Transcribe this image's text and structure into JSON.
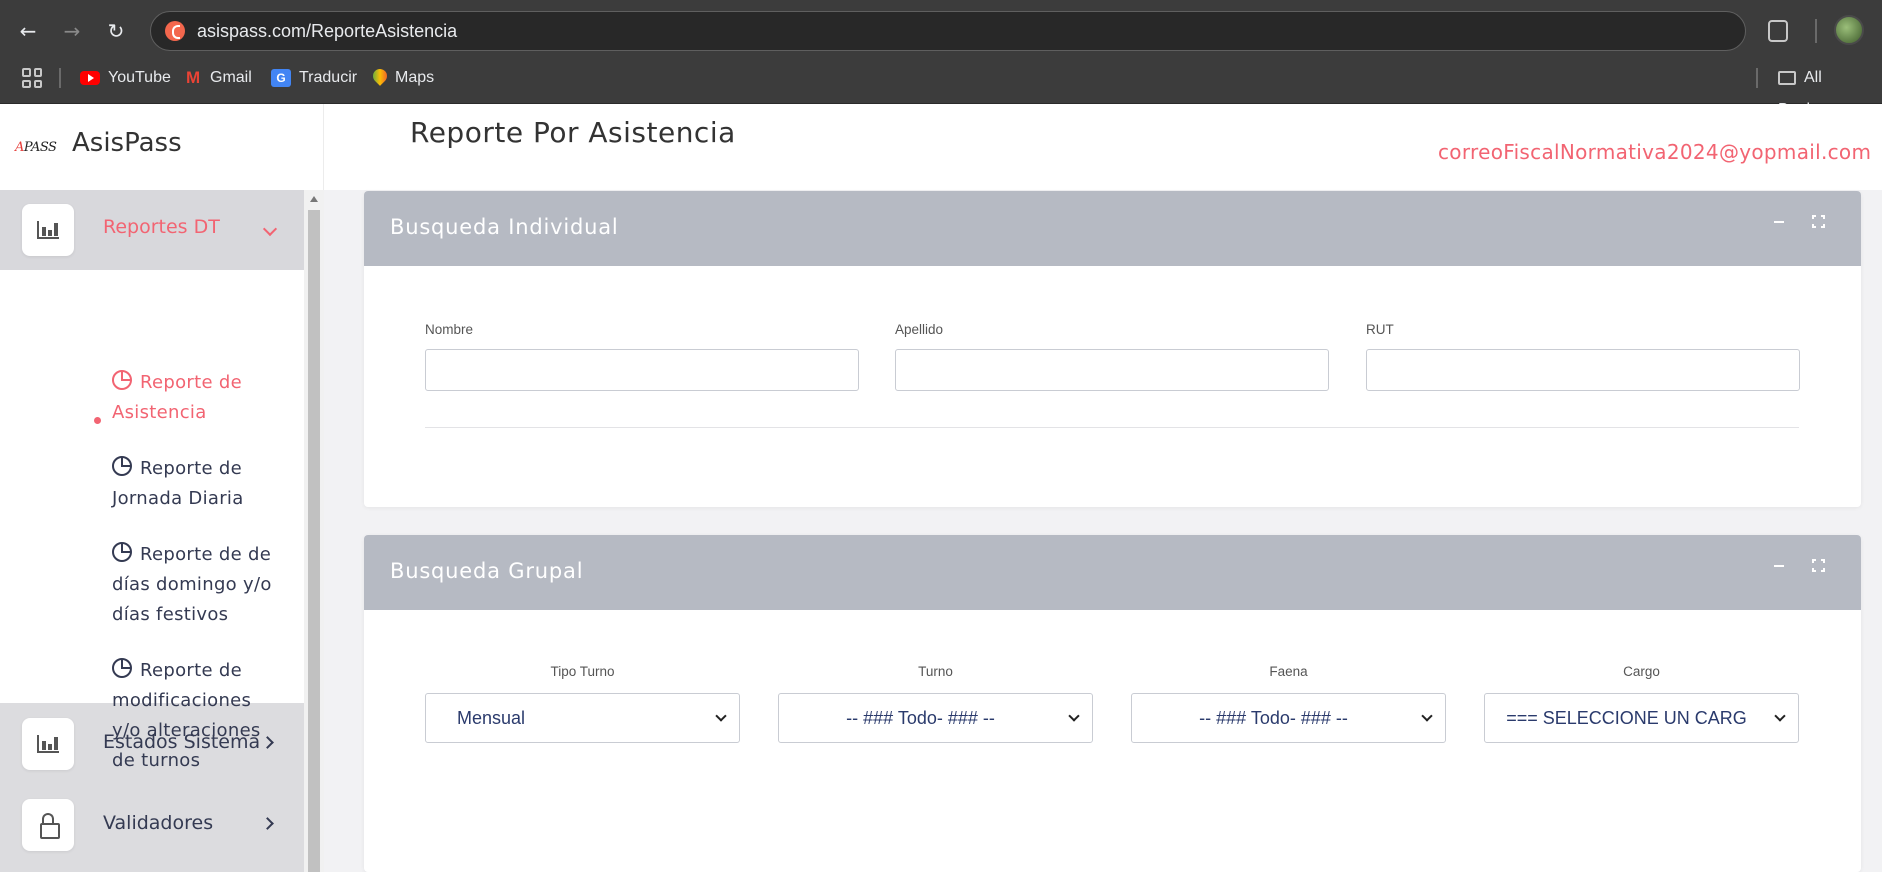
{
  "browser": {
    "url": "asispass.com/ReporteAsistencia",
    "bookmarks": [
      {
        "label": "YouTube",
        "icon": "youtube-icon"
      },
      {
        "label": "Gmail",
        "icon": "gmail-icon"
      },
      {
        "label": "Traducir",
        "icon": "translate-icon"
      },
      {
        "label": "Maps",
        "icon": "maps-icon"
      }
    ],
    "all_bookmarks_label": "All Bookma"
  },
  "brand": {
    "logo_text_prefix": "A",
    "logo_text_main": "PASS",
    "name": "AsisPass"
  },
  "sidebar": {
    "active_menu": {
      "label": "Reportes DT",
      "icon": "bar-chart-icon"
    },
    "sub_items": [
      {
        "label": "Reporte de Asistencia",
        "active": true,
        "icon": "pie-chart-icon"
      },
      {
        "label": "Reporte de Jornada Diaria",
        "active": false,
        "icon": "pie-chart-icon"
      },
      {
        "label": "Reporte de de días domingo y/o días festivos",
        "active": false,
        "icon": "pie-chart-icon"
      },
      {
        "label": "Reporte de modificaciones y/o alteraciones de turnos",
        "active": false,
        "icon": "pie-chart-icon"
      }
    ],
    "menu_items": [
      {
        "label": "Estados Sistema",
        "icon": "bar-chart-icon"
      },
      {
        "label": "Validadores",
        "icon": "lock-icon"
      }
    ]
  },
  "header": {
    "title": "Reporte Por Asistencia",
    "user_email": "correoFiscalNormativa2024@yopmail.com"
  },
  "individual_search": {
    "title": "Busqueda Individual",
    "fields": [
      {
        "label": "Nombre",
        "value": ""
      },
      {
        "label": "Apellido",
        "value": ""
      },
      {
        "label": "RUT",
        "value": ""
      }
    ]
  },
  "group_search": {
    "title": "Busqueda Grupal",
    "selects": [
      {
        "label": "Tipo Turno",
        "value": "Mensual"
      },
      {
        "label": "Turno",
        "value": "-- ### Todo- ### --"
      },
      {
        "label": "Faena",
        "value": "-- ### Todo- ### --"
      },
      {
        "label": "Cargo",
        "value": "=== SELECCIONE UN CARG"
      }
    ]
  },
  "colors": {
    "accent": "#f26472",
    "card_header": "#b6bac3",
    "text_dark": "#343a52"
  }
}
